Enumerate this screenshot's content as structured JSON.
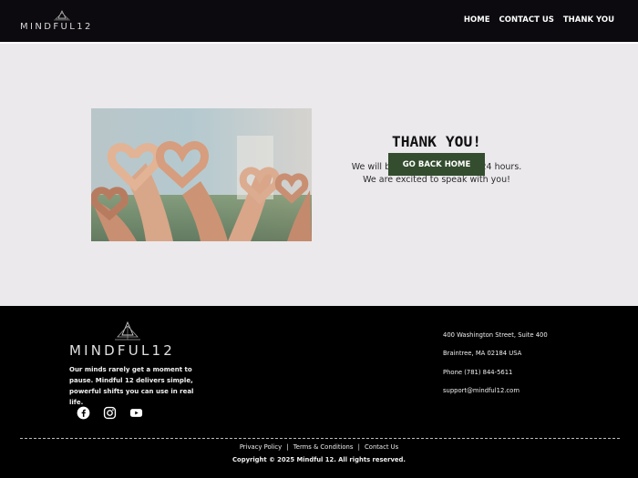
{
  "header": {
    "logo_text": "MINDFUL12",
    "nav": [
      {
        "label": "HOME"
      },
      {
        "label": "CONTACT US"
      },
      {
        "label": "THANK YOU"
      }
    ]
  },
  "main": {
    "heading": "THANK YOU!",
    "line1": "We will be back to you within 24 hours.",
    "line2": "We are excited to speak with you!",
    "button_label": "GO BACK HOME",
    "button_color": "#334d2e",
    "background_color": "#ebe9ec"
  },
  "footer": {
    "logo_text": "MINDFUL12",
    "tagline": "Our minds rarely get a moment to pause. Mindful 12 delivers simple, powerful shifts you can use in real life.",
    "social_icons": [
      "facebook-icon",
      "instagram-icon",
      "youtube-icon"
    ],
    "contact": {
      "address1": "400 Washington Street, Suite 400",
      "address2": "Braintree, MA 02184 USA",
      "phone": "Phone (781) 844-5611",
      "email": "support@mindful12.com"
    },
    "links": {
      "privacy": "Privacy Policy",
      "sep1": "|",
      "terms": "Terms & Conditions",
      "sep2": "|",
      "contact": "Contact Us"
    },
    "copyright": "Copyright © 2025 Mindful 12. All rights reserved."
  }
}
